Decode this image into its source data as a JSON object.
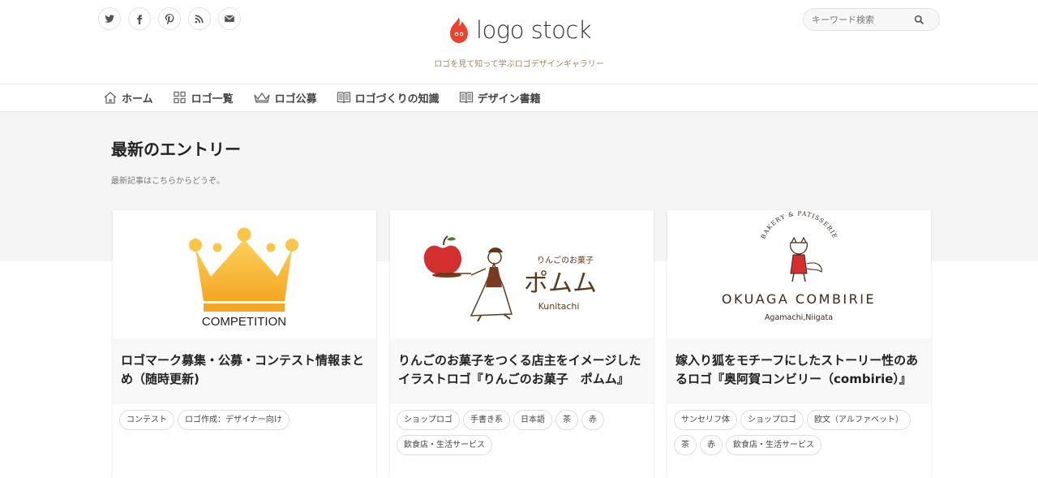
{
  "header": {
    "logo_text": "logo stock",
    "tagline": "ロゴを見て知って学ぶロゴデザインギャラリー",
    "search_placeholder": "キーワード検索",
    "social": [
      "twitter-icon",
      "facebook-icon",
      "pinterest-icon",
      "rss-icon",
      "mail-icon"
    ]
  },
  "nav": {
    "items": [
      {
        "label": "ホーム",
        "icon": "home-icon"
      },
      {
        "label": "ロゴ一覧",
        "icon": "grid-icon"
      },
      {
        "label": "ロゴ公募",
        "icon": "crown-icon"
      },
      {
        "label": "ロゴづくりの知識",
        "icon": "book-icon"
      },
      {
        "label": "デザイン書籍",
        "icon": "book-icon"
      }
    ]
  },
  "section": {
    "title": "最新のエントリー",
    "subtitle": "最新記事はこちらからどうぞ。"
  },
  "cards": [
    {
      "thumb_text": "COMPETITION",
      "title": "ロゴマーク募集・公募・コンテスト情報まとめ（随時更新)",
      "tags": [
        "コンテスト",
        "ロゴ作成：デザイナー向け"
      ]
    },
    {
      "thumb_text_1": "りんごのお菓子",
      "thumb_text_2": "ポムム",
      "thumb_text_3": "Kunitachi",
      "title": "りんごのお菓子をつくる店主をイメージしたイラストロゴ『りんごのお菓子　ポムム』",
      "tags": [
        "ショップロゴ",
        "手書き系",
        "日本語",
        "茶",
        "赤",
        "飲食店・生活サービス"
      ]
    },
    {
      "thumb_text_1": "BAKERY & PATISSERIE",
      "thumb_text_2": "OKUAGA COMBIRIE",
      "thumb_text_3": "Agamachi,Niigata",
      "title": "嫁入り狐をモチーフにしたストーリー性のあるロゴ『奥阿賀コンビリー（combirie）』",
      "tags": [
        "サンセリフ体",
        "ショップロゴ",
        "欧文（アルファベット）",
        "茶",
        "赤",
        "飲食店・生活サービス"
      ]
    }
  ],
  "colors": {
    "accent": "#e8452c",
    "gold": "#f7b733",
    "tagline": "#a08a55"
  }
}
